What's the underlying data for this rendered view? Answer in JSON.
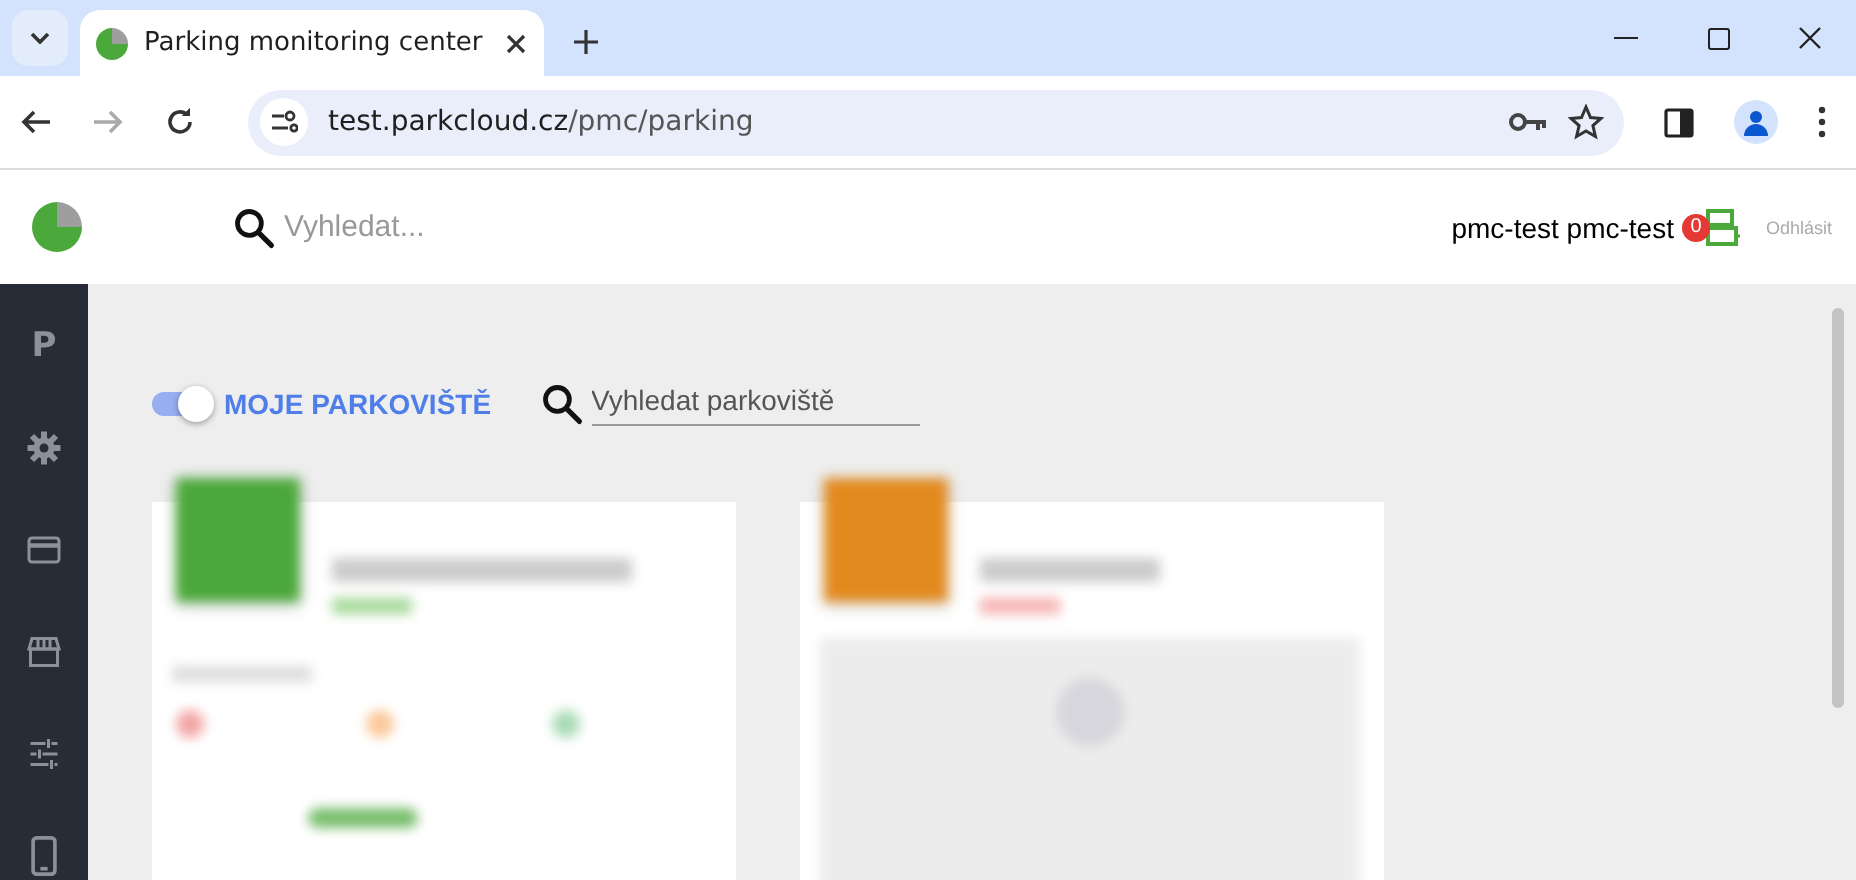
{
  "browser": {
    "tab_title": "Parking monitoring center",
    "url_host": "test.parkcloud.cz",
    "url_path": "/pmc/parking"
  },
  "header": {
    "search": {
      "placeholder": "Vyhledat..."
    },
    "user": "pmc-test pmc-test",
    "badge": "0",
    "logout": "Odhlásit"
  },
  "sidebar": {
    "items": [
      {
        "kind": "letter",
        "label": "P"
      },
      {
        "kind": "gear"
      },
      {
        "kind": "card"
      },
      {
        "kind": "store"
      },
      {
        "kind": "sliders"
      },
      {
        "kind": "phone"
      }
    ]
  },
  "filter": {
    "toggle": {
      "on": true,
      "label": "MOJE PARKOVIŠTĚ"
    },
    "search": {
      "placeholder": "Vyhledat parkoviště"
    }
  },
  "cards": [
    {
      "kind": "stats",
      "color": "#4ba83a"
    },
    {
      "kind": "empty",
      "color": "#e38a1f"
    }
  ]
}
